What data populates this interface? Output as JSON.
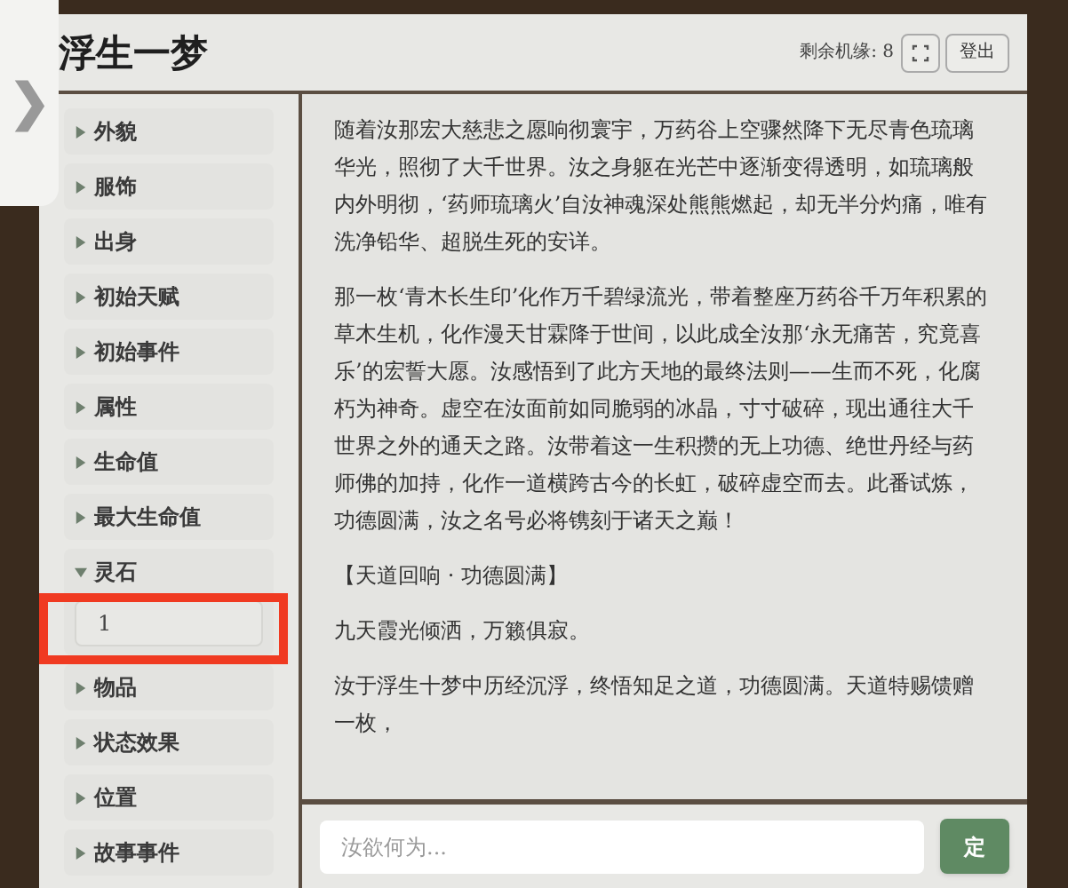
{
  "side_tab": {
    "glyph": "❯"
  },
  "header": {
    "title": "浮生一梦",
    "chances": "剩余机缘: 8",
    "logout": "登出"
  },
  "sidebar": {
    "items": [
      {
        "label": "外貌",
        "expanded": false
      },
      {
        "label": "服饰",
        "expanded": false
      },
      {
        "label": "出身",
        "expanded": false
      },
      {
        "label": "初始天赋",
        "expanded": false
      },
      {
        "label": "初始事件",
        "expanded": false
      },
      {
        "label": "属性",
        "expanded": false
      },
      {
        "label": "生命值",
        "expanded": false
      },
      {
        "label": "最大生命值",
        "expanded": false
      },
      {
        "label": "灵石",
        "expanded": true,
        "value": "1",
        "highlighted": true
      },
      {
        "label": "物品",
        "expanded": false
      },
      {
        "label": "状态效果",
        "expanded": false
      },
      {
        "label": "位置",
        "expanded": false
      },
      {
        "label": "故事事件",
        "expanded": false
      }
    ]
  },
  "story": {
    "paragraphs": [
      "随着汝那宏大慈悲之愿响彻寰宇，万药谷上空骤然降下无尽青色琉璃华光，照彻了大千世界。汝之身躯在光芒中逐渐变得透明，如琉璃般内外明彻，‘药师琉璃火’自汝神魂深处熊熊燃起，却无半分灼痛，唯有洗净铅华、超脱生死的安详。",
      "那一枚‘青木长生印’化作万千碧绿流光，带着整座万药谷千万年积累的草木生机，化作漫天甘霖降于世间，以此成全汝那‘永无痛苦，究竟喜乐’的宏誓大愿。汝感悟到了此方天地的最终法则——生而不死，化腐朽为神奇。虚空在汝面前如同脆弱的冰晶，寸寸破碎，现出通往大千世界之外的通天之路。汝带着这一生积攒的无上功德、绝世丹经与药师佛的加持，化作一道横跨古今的长虹，破碎虚空而去。此番试炼，功德圆满，汝之名号必将镌刻于诸天之巅！",
      "【天道回响 · 功德圆满】",
      "九天霞光倾洒，万籁俱寂。",
      "汝于浮生十梦中历经沉浮，终悟知足之道，功德圆满。天道特赐馈赠一枚，"
    ]
  },
  "input": {
    "placeholder": "汝欲何为...",
    "submit": "定"
  }
}
